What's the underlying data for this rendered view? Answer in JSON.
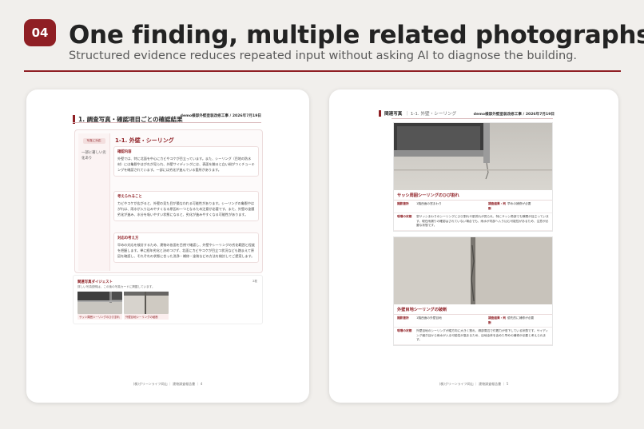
{
  "header": {
    "badge": "04",
    "title": "One finding, multiple related photographs",
    "subtitle": "Structured evidence reduces repeated input without asking AI to diagnose the building."
  },
  "left_page": {
    "section_title": "1. 調査写真・確認項目ごとの確認結果",
    "doc_meta": "demo様邸外壁塗装改修工事 / 2026年7月19日",
    "finding": {
      "tag": "写真に対応",
      "side_label": "一部に著しい劣化あり",
      "heading": "1-1. 外壁・シーリング",
      "blocks": [
        {
          "heading": "確認内容",
          "text": "外壁では、特に北面を中心にカビやコケが目立っています。また、シーリング（目地の防水材）には亀裂やはがれが見られ、外壁サイディングには、表面を触ると白い粉がつくチョーキングを確認されています。一部には劣化が進んでいる箇所があります。"
        },
        {
          "heading": "考えられること",
          "text": "カビやコケが広がると、外壁の見た目が損なわれる可能性があります。シーリングの亀裂やはがれは、雨水が入り込みやすくなる原因の一つとなるため注意が必要です。また、外壁の塗膜劣化が進み、水分を吸いやすい状態になると、劣化が進みやすくなる可能性があります。"
        },
        {
          "heading": "対応の考え方",
          "text": "早めの対応を検討するため、建物の各面を目視で確認し、外壁やシーリングの劣化範囲と程度を把握します。単に経年劣化と決めつけず、北面にカビやコケが目立つ状況なども踏まえて原因を確認し、それぞれの状態に合った洗浄・補修・塗装などの方法を検討してご提案します。"
        }
      ]
    },
    "digest": {
      "title": "関連写真ダイジェスト",
      "subtitle": "詳しい写真説明は、この後の写真カードに掲載しています。",
      "count": "2枚",
      "photos": [
        {
          "caption": "サッシ周囲シーリングのひび割れ"
        },
        {
          "caption": "外壁目地シーリングの破断"
        }
      ]
    },
    "footer": "(株)グリーンライフ岡山 ｜ 建物調査報告書 ｜ 4"
  },
  "right_page": {
    "section_title": "関連写真",
    "section_sub": "｜ 1-1. 外壁・シーリング",
    "doc_meta": "demo様邸外壁塗装改修工事 / 2026年7月19日",
    "cards": [
      {
        "title": "サッシ周囲シーリングのひび割れ",
        "location_label": "撮影箇所",
        "location": "1階西面の窓まわり",
        "judgment_label": "調査結果・判断",
        "judgment": "早めの補修が必要",
        "note_label": "現場の状態",
        "note": "窓サッシまわりのシーリングにひび割れや肌荒れが見られ、特にサッシ角部でも隙間が目立っています。現在雨漏りの確認はされていない場合でも、雨水が内部へ入り込む可能性があるため、注意が必要な状態です。"
      },
      {
        "title": "外壁目地シーリングの破断",
        "location_label": "撮影箇所",
        "location": "1階西面の外壁目地",
        "judgment_label": "調査結果・判断",
        "judgment": "優先的に補修が必要",
        "note_label": "現場の状態",
        "note": "外壁目地のシーリングが縦方向に大きく割れ、縁部周辺で付着力が低下している状態です。サイディング継ぎ目から雨水が入る可能性が高まるため、目地全体を含めた早めの補修が必要と考えられます。"
      }
    ],
    "footer": "(株)グリーンライフ岡山 ｜ 建物調査報告書 ｜ 5"
  },
  "colors": {
    "accent": "#8f1f24",
    "background": "#f1efec"
  }
}
